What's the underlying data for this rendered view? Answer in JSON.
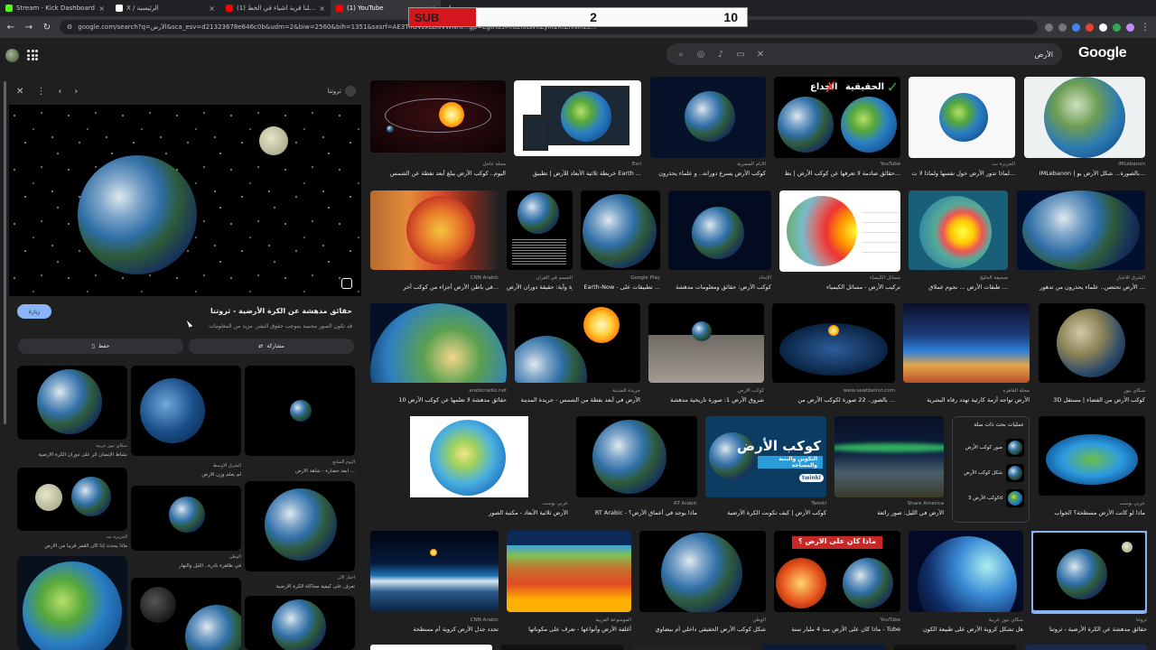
{
  "browser": {
    "tabs": [
      {
        "title": "Stream - Kick Dashboard",
        "color": "#53fc18",
        "active": false
      },
      {
        "title": "X / الرئيسية",
        "color": "#ffffff",
        "active": false
      },
      {
        "title": "(1) دخلنا قرية اشياء في الخط",
        "color": "#ff0000",
        "active": false
      },
      {
        "title": "(1) YouTube",
        "color": "#ff0000",
        "active": true
      }
    ],
    "url": "google.com/search?q=الأرض&sca_esv=d21323678e646c0b&udm=2&biw=2560&bih=1351&sxsrf=AE3TifOVzxLD8VWNr0...gp=Egtnd3Mfd2l6LWltZylK2KfZhNin2L..."
  },
  "sub_counter": {
    "label": "SUB",
    "current": "2",
    "goal": "10"
  },
  "search": {
    "query": "الأرض",
    "logo": "Google"
  },
  "panel": {
    "source": "ثروتنا",
    "title": "حقائق مدهشة عن الكرة الأرضية - ثروتنا",
    "desc": "قد تكون الصور محمية بموجب حقوق النشر. مزيد من المعلومات",
    "visit": "زيارة",
    "share": "مشاركة",
    "save": "حفظ",
    "related": [
      {
        "source": "اليوم السابع",
        "caption": "ابعد حضارة - شاهد الأرض ..."
      },
      {
        "source": "الشرق الأوسط",
        "caption": "لم يعلم وزن الأرض"
      },
      {
        "source": "سكاي نيوز عربية",
        "caption": "نشاط الإنسان أثر على دوران الكرة الأرضية"
      },
      {
        "source": "الخليج",
        "caption": "الأرض الصغيرة"
      },
      {
        "source": "الجزيرة نت",
        "caption": "ماذا يحدث إذا كان القمر قريبا من الأرض"
      },
      {
        "source": "الوطن",
        "caption": "في ظاهرة نادرة.. الليل والنهار"
      },
      {
        "source": "أخبار الآن",
        "caption": "تعرف على كيفية محاكاة الكرة الأرضية"
      }
    ]
  },
  "grid": {
    "row1": [
      {
        "src": "IMLebanon",
        "cap": "IMLebanon | بالصورة... شكل الأرض يو..."
      },
      {
        "src": "الجزيرة نت",
        "cap": "لماذا تدور الأرض حول نفسها ولماذا لا ت..."
      },
      {
        "src": "YouTube",
        "cap": "حقائق صادمة لا تعرفها عن كوكب الأرض | نظ..."
      },
      {
        "src": "الأيام المصرية",
        "cap": "كوكب الأرض يسرع دورانه.. و علماء يحذرون"
      },
      {
        "src": "Esri",
        "cap": "خريطة ثلاثية الأبعاد للأرض | تطبيق Earth ..."
      },
      {
        "src": "مجلة عاجل",
        "cap": "اليوم.. كوكب الأرض يبلغ أبعد نقطة عن الشمس"
      }
    ],
    "row2": [
      {
        "src": "الشرق للأخبار",
        "cap": "الأرض تحتضن.. علماء يحذرون من تدهور ..."
      },
      {
        "src": "صحيفة الخليج",
        "cap": "طبقات الأرض ... نجوم عملاق ... "
      },
      {
        "src": "مسائل الكيمياء",
        "cap": "تركيب الأرض - مسائل الكيمياء"
      },
      {
        "src": "الإتحاد",
        "cap": "كوكب الأرض: حقائق ومعلومات مدهشة"
      },
      {
        "src": "Google Play",
        "cap": "Earth-Now - تطبيقات على ..."
      },
      {
        "src": "الجسم في القرآن",
        "cap": "صورة وأية: حقيقة دوران الأرض"
      },
      {
        "src": "CNN Arabic",
        "cap": "في باطن الأرض أجزاء من كوكب آخر..."
      }
    ],
    "row3": [
      {
        "src": "سكاي نيوز",
        "cap": "3D كوكب الأرض من الفضاء | مستقل"
      },
      {
        "src": "مجلة القاهرة",
        "cap": "الأرض تواجه أزمة كارثية تهدد رفاه البشرية"
      },
      {
        "src": "www.sawtbeirut.com",
        "cap": "بالصور.. 22 صورة لكوكب الأرض من ..."
      },
      {
        "src": "كوكب الأرض",
        "cap": "شروق الأرض 1: صورة تاريخية مدهشة"
      },
      {
        "src": "جريدة المدينة",
        "cap": "الأرض في أبعد نقطة من الشمس - جريدة المدينة"
      },
      {
        "src": "arabicradio.net",
        "cap": "10 حقائق مدهشة لا تعلمها عن كوكب الأرض"
      }
    ],
    "row4": [
      {
        "src": "عربي بوست",
        "cap": "ماذا لو كانت الأرض مسطحة؟ الجواب"
      },
      {
        "src": "Share America",
        "cap": "الأرض في الليل: صور رائعة"
      },
      {
        "src": "Twinkl",
        "cap": "كوكب الأرض | كيف تكونت الكرة الأرضية"
      },
      {
        "src": "RT Arabic",
        "cap": "RT Arabic - ماذا يوجد في أعماق الأرض؟"
      },
      {
        "src": "عربي بوست",
        "cap": "الأرض ثلاثية الأبعاد - مكتبة الصور"
      }
    ],
    "row5": [
      {
        "src": "ثروتنا",
        "cap": "حقائق مدهشة عن الكرة الأرضية - ثروتنا"
      },
      {
        "src": "سكاي نيوز عربية",
        "cap": "هل تشكل كروية الأرض على طبيعة الكون"
      },
      {
        "src": "YouTube",
        "cap": "ماذا كان على الأرض منذ 4 مليار سنة - Tube"
      },
      {
        "src": "الوطن",
        "cap": "شكل كوكب الأرض الحقيقي داخلي أم بيضاوي"
      },
      {
        "src": "الموسوعة العربية",
        "cap": "أغلفة الأرض وأنواعها - تعرف على مكوناتها"
      },
      {
        "src": "CNN Arabic",
        "cap": "تجدد جدل الأرض كروية أم مسطحة"
      }
    ],
    "banners": {
      "fake_real_left": "الخداع",
      "fake_real_right": "الحقيقية",
      "kawkab_title": "كوكب الأرض",
      "kawkab_sub": "التكوين والبنية والمساحة",
      "twinkl": "twinkl",
      "what_was": "ماذا كان على الارض ؟"
    },
    "related_searches": {
      "title": "عمليات بحث ذات صلة",
      "items": [
        "صور كوكب الأرض",
        "شكل كوكب الأرض",
        "كوكب الأرض 3d"
      ]
    }
  }
}
